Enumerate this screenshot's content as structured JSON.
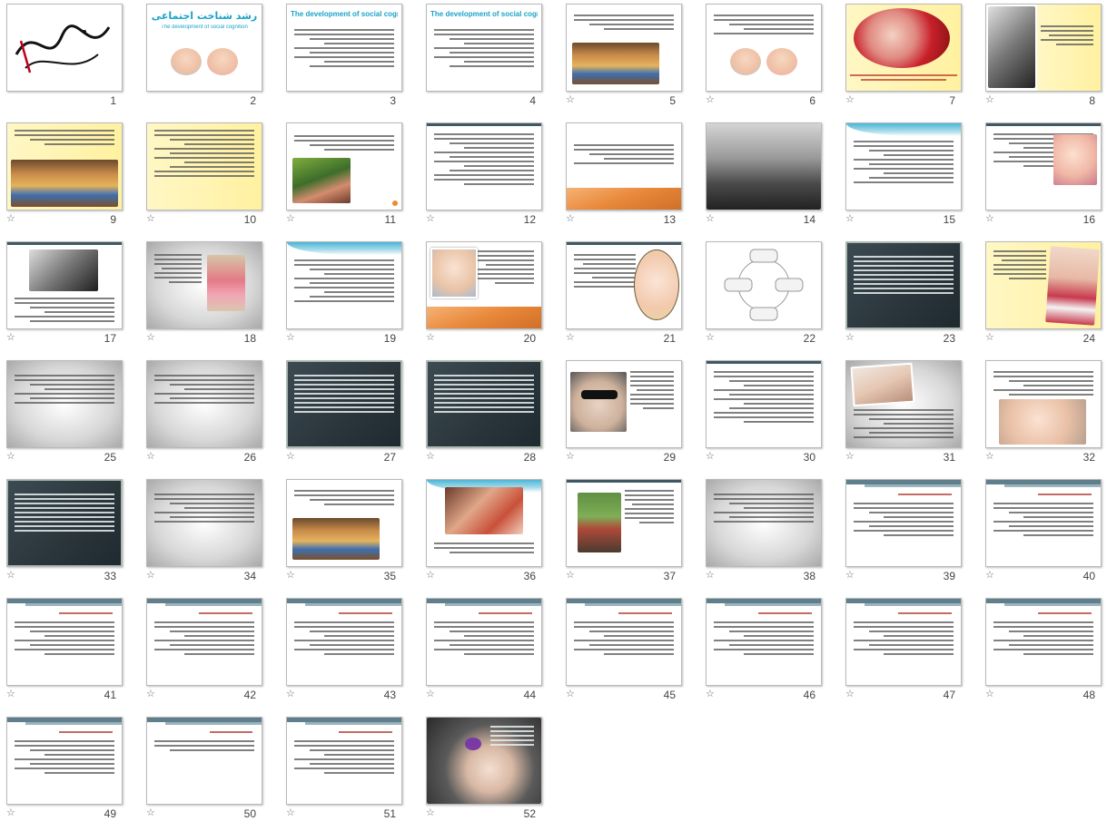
{
  "slides": [
    {
      "n": "1",
      "style": "calligraphy",
      "star": false
    },
    {
      "n": "2",
      "style": "title-babies",
      "star": false,
      "title": "رشد شناخت اجتماعی",
      "subtitle": "The development of social cognition"
    },
    {
      "n": "3",
      "style": "title-text",
      "star": false,
      "title": "The development of social cognition"
    },
    {
      "n": "4",
      "style": "title-text",
      "star": false,
      "title": "The development of social cognition"
    },
    {
      "n": "5",
      "style": "text-photo",
      "star": true
    },
    {
      "n": "6",
      "style": "babies",
      "star": true
    },
    {
      "n": "7",
      "style": "oval-photo-yellow",
      "star": true
    },
    {
      "n": "8",
      "style": "bw-photo-text",
      "star": true
    },
    {
      "n": "9",
      "style": "yellow-photo",
      "star": true
    },
    {
      "n": "10",
      "style": "yellow-text",
      "star": true
    },
    {
      "n": "11",
      "style": "hands-photo",
      "star": true
    },
    {
      "n": "12",
      "style": "text",
      "star": true
    },
    {
      "n": "13",
      "style": "orange-foot",
      "star": true
    },
    {
      "n": "14",
      "style": "bw-photo",
      "star": true
    },
    {
      "n": "15",
      "style": "wave-text",
      "star": true
    },
    {
      "n": "16",
      "style": "text-baby",
      "star": true
    },
    {
      "n": "17",
      "style": "bw-photo-bottom-text",
      "star": true
    },
    {
      "n": "18",
      "style": "grey-photo",
      "star": true
    },
    {
      "n": "19",
      "style": "wave-text",
      "star": true
    },
    {
      "n": "20",
      "style": "photo-orange",
      "star": true
    },
    {
      "n": "21",
      "style": "oval-baby",
      "star": true
    },
    {
      "n": "22",
      "style": "diagram",
      "star": true
    },
    {
      "n": "23",
      "style": "dark-text",
      "star": true
    },
    {
      "n": "24",
      "style": "yellow-baby",
      "star": true
    },
    {
      "n": "25",
      "style": "grey-text",
      "star": true
    },
    {
      "n": "26",
      "style": "grey-text",
      "star": true
    },
    {
      "n": "27",
      "style": "dark-text",
      "star": true
    },
    {
      "n": "28",
      "style": "dark-text",
      "star": true
    },
    {
      "n": "29",
      "style": "sunglasses",
      "star": true
    },
    {
      "n": "30",
      "style": "text",
      "star": true
    },
    {
      "n": "31",
      "style": "grey-photo-top",
      "star": true
    },
    {
      "n": "32",
      "style": "text-baby-bottom",
      "star": true
    },
    {
      "n": "33",
      "style": "dark-text",
      "star": true
    },
    {
      "n": "34",
      "style": "grey-text",
      "star": true
    },
    {
      "n": "35",
      "style": "text-photo",
      "star": true
    },
    {
      "n": "36",
      "style": "wave-photo",
      "star": true
    },
    {
      "n": "37",
      "style": "photo-left",
      "star": true
    },
    {
      "n": "38",
      "style": "grey-text",
      "star": true
    },
    {
      "n": "39",
      "style": "article",
      "star": true
    },
    {
      "n": "40",
      "style": "article",
      "star": true
    },
    {
      "n": "41",
      "style": "article",
      "star": true
    },
    {
      "n": "42",
      "style": "article",
      "star": true
    },
    {
      "n": "43",
      "style": "article",
      "star": true
    },
    {
      "n": "44",
      "style": "article",
      "star": true
    },
    {
      "n": "45",
      "style": "article",
      "star": true
    },
    {
      "n": "46",
      "style": "article",
      "star": true
    },
    {
      "n": "47",
      "style": "article",
      "star": true
    },
    {
      "n": "48",
      "style": "article",
      "star": true
    },
    {
      "n": "49",
      "style": "article",
      "star": true
    },
    {
      "n": "50",
      "style": "article-light",
      "star": true
    },
    {
      "n": "51",
      "style": "article",
      "star": true
    },
    {
      "n": "52",
      "style": "baby-flower",
      "star": true
    }
  ],
  "star_glyph": "☆"
}
